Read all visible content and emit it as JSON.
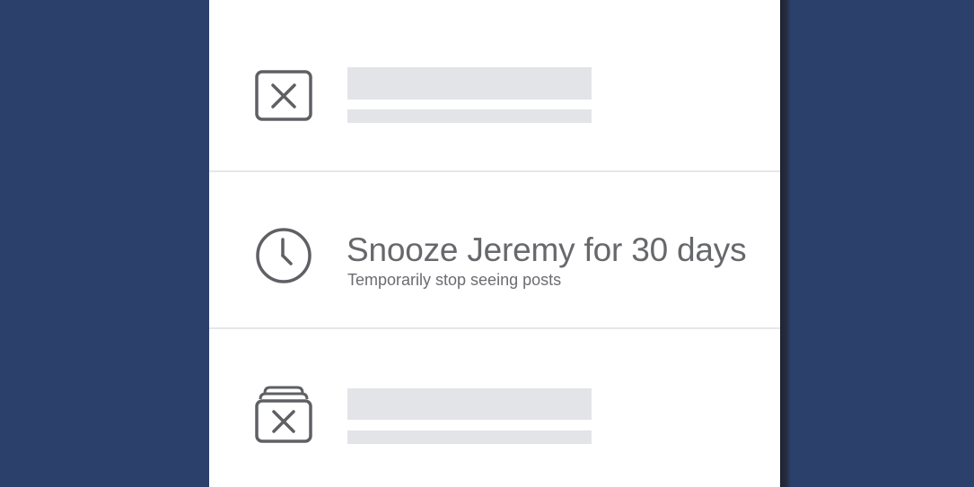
{
  "colors": {
    "background": "#2b416c",
    "panel": "#ffffff",
    "icon_stroke": "#5f6064",
    "text_primary": "#67686c",
    "placeholder": "#e3e4e8",
    "divider": "#e6e7ea"
  },
  "menu": {
    "items": [
      {
        "icon": "close-box-icon",
        "title": "",
        "subtitle": "",
        "placeholder": true
      },
      {
        "icon": "clock-icon",
        "title": "Snooze Jeremy for 30 days",
        "subtitle": "Temporarily stop seeing posts",
        "placeholder": false
      },
      {
        "icon": "stacked-close-box-icon",
        "title": "",
        "subtitle": "",
        "placeholder": true
      }
    ]
  }
}
